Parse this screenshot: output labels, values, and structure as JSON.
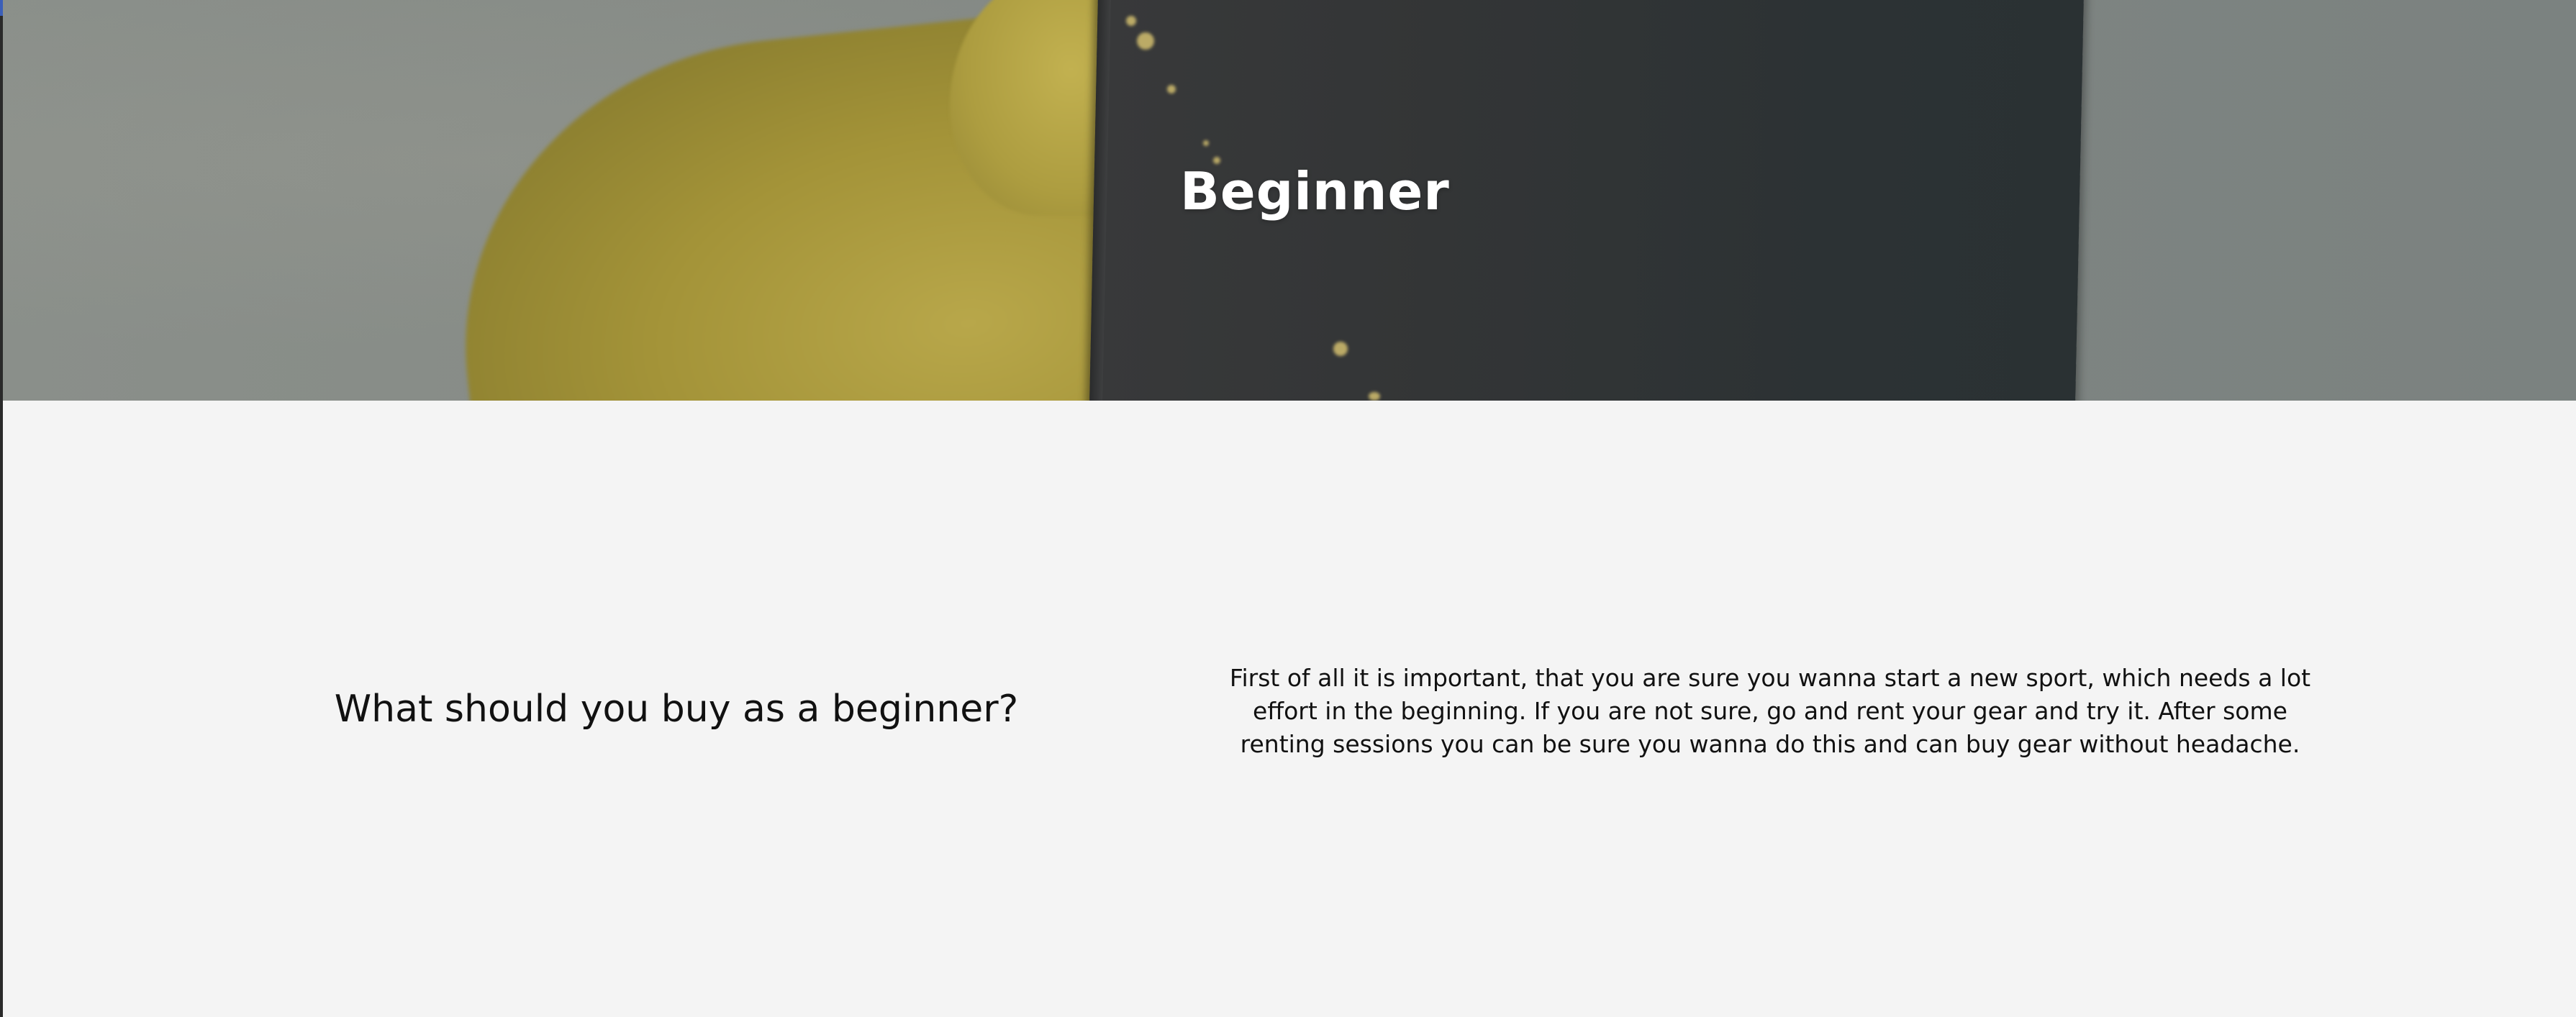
{
  "hero": {
    "title": "Beginner",
    "image_description": "person in yellow jacket holding a dark snowboard"
  },
  "section": {
    "heading": "What should you buy as a beginner?",
    "body": "First of all it is important, that you are sure you wanna start a new sport, which needs a lot effort in the beginning. If you are not sure, go and rent your gear and try it. After some renting sessions you can be sure you wanna do this and can buy gear without headache."
  },
  "colors": {
    "page_background": "#f4f4f4",
    "hero_text": "#ffffff",
    "body_text": "#111111",
    "jacket_yellow": "#a39338",
    "board_dark": "#2f3436"
  }
}
